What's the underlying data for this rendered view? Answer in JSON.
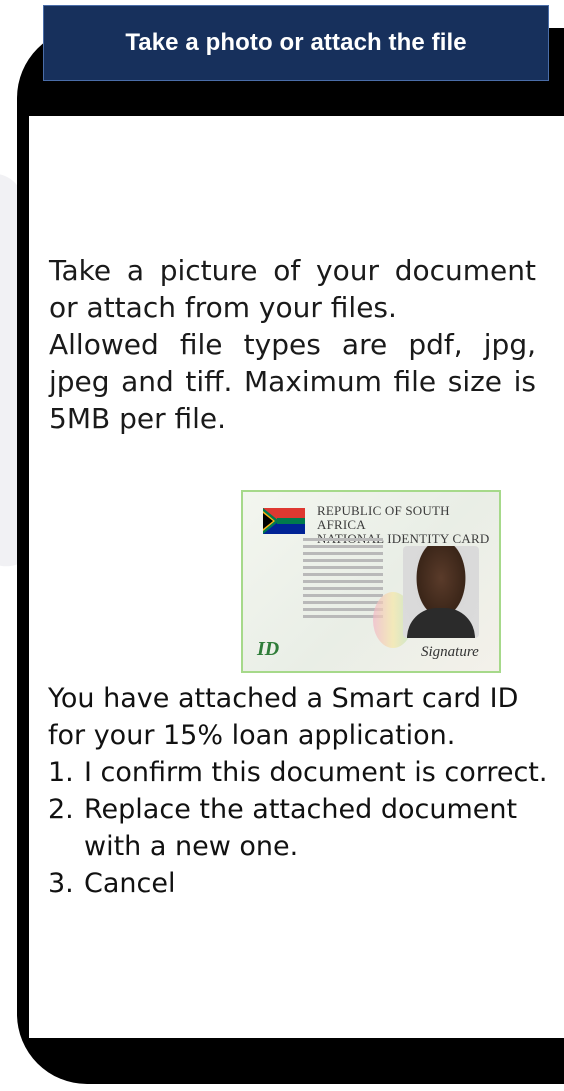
{
  "header": {
    "title": "Take a photo or attach the file"
  },
  "instructions": {
    "paragraph1": "Take a picture of your document or attach from your files.",
    "paragraph2": "Allowed file types are pdf, jpg, jpeg and tiff. Maximum file size is 5MB per file."
  },
  "id_card": {
    "title_line1": "REPUBLIC OF SOUTH AFRICA",
    "title_line2": "NATIONAL IDENTITY CARD",
    "logo_text": "ID",
    "signature_text": "Signature"
  },
  "confirmation": {
    "message": "You have attached a Smart card ID for your 15% loan application.",
    "options": [
      {
        "number": "1.",
        "label": "I confirm this document is correct."
      },
      {
        "number": "2.",
        "label": "Replace the attached document with a new one."
      },
      {
        "number": "3.",
        "label": "Cancel"
      }
    ]
  },
  "colors": {
    "header_bg": "#17305c",
    "phone_frame": "#000000",
    "card_border": "#a6d98a"
  }
}
